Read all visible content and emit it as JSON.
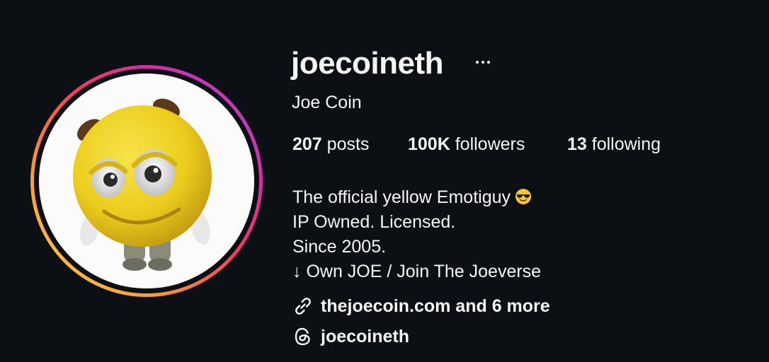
{
  "profile": {
    "username": "joecoineth",
    "full_name": "Joe Coin",
    "more_icon": "ellipsis-icon"
  },
  "stats": {
    "posts_count": "207",
    "posts_label": "posts",
    "followers_count": "100K",
    "followers_label": "followers",
    "following_count": "13",
    "following_label": "following"
  },
  "bio": {
    "line1": "The official yellow Emotiguy",
    "line1_emoji": "😎",
    "line2": "IP Owned. Licensed.",
    "line3": "Since 2005.",
    "line4": "↓ Own JOE / Join The Joeverse"
  },
  "links": {
    "website_text": "thejoecoin.com and 6 more",
    "website_icon": "link-icon",
    "threads_handle": "joecoineth",
    "threads_icon": "threads-icon"
  },
  "colors": {
    "background": "#0c1014",
    "text": "#f5f5f5",
    "avatar_ring_start": "#fdd35a",
    "avatar_ring_end": "#a34bd9",
    "character_yellow": "#f2d21f"
  }
}
